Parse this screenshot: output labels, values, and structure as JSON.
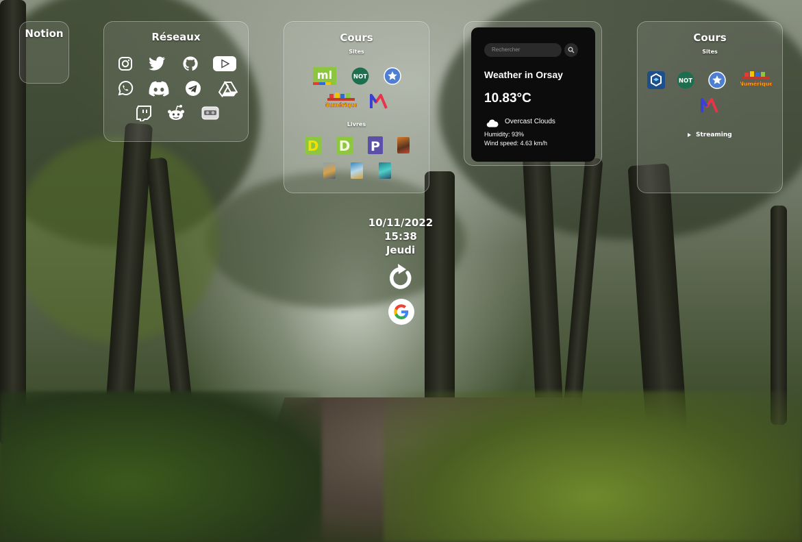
{
  "notion": {
    "title": "Notion"
  },
  "reseaux": {
    "title": "Réseaux",
    "icons": [
      "instagram-icon",
      "twitter-icon",
      "github-icon",
      "youtube-icon",
      "whatsapp-icon",
      "discord-icon",
      "telegram-icon",
      "google-drive-icon",
      "twitch-icon",
      "reddit-icon",
      "vr-headset-icon"
    ]
  },
  "cours_left": {
    "title": "Cours",
    "sites_label": "Sites",
    "livres_label": "Livres",
    "site_icons": [
      "ml-icon",
      "not-icon",
      "star-icon",
      "numerique-icon",
      "m-logo-icon"
    ],
    "livre_icons": [
      "d-book-icon",
      "d-book-icon",
      "p-book-icon",
      "book-cover-icon",
      "book-cover-icon",
      "book-cover-icon",
      "book-cover-icon"
    ]
  },
  "weather": {
    "search_placeholder": "Rechercher",
    "title": "Weather in Orsay",
    "temperature": "10.83°C",
    "description": "Overcast Clouds",
    "humidity": "Humidity: 93%",
    "wind": "Wind speed: 4.63 km/h"
  },
  "cours_right": {
    "title": "Cours",
    "sites_label": "Sites",
    "site_icons": [
      "blue-cube-icon",
      "not-icon",
      "star-icon",
      "numerique-icon",
      "m-logo-icon"
    ],
    "streaming_label": "Streaming"
  },
  "clock": {
    "date": "10/11/2022",
    "time": "15:38",
    "day": "Jeudi"
  },
  "actions": {
    "refresh": "refresh-icon",
    "google": "google-icon"
  },
  "colors": {
    "ml_green": "#8cc63f",
    "not_green": "#1c6e4f",
    "star_blue": "#4f7fd0",
    "d_green": "#8dc63f",
    "p_purple": "#5b4fa8"
  }
}
